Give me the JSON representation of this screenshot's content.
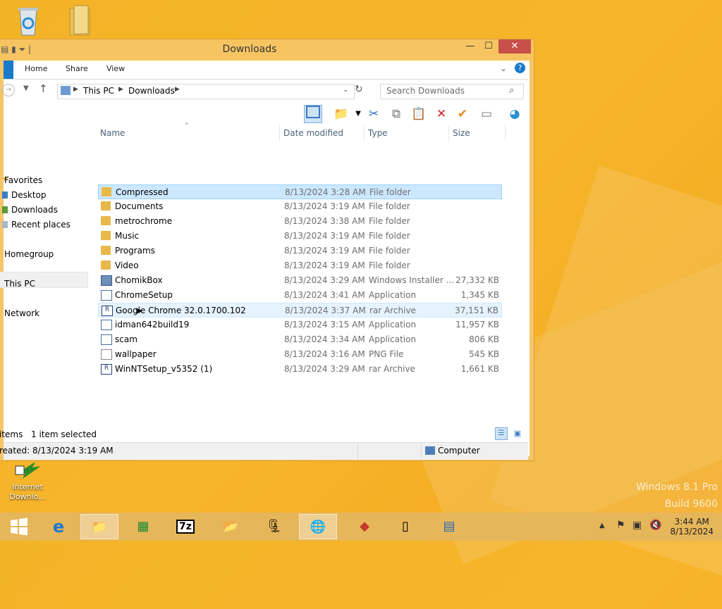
{
  "desktop": {
    "icons": [
      {
        "name": "recycle-bin-icon",
        "label": ""
      },
      {
        "name": "folder-icon",
        "label": ""
      },
      {
        "name": "internet-download-manager-icon",
        "label": "Internet Downlo..."
      }
    ],
    "watermark_line1": "Windows 8.1 Pro",
    "watermark_line2": "Build 9600"
  },
  "window": {
    "title": "Downloads",
    "controls": {
      "minimize": "—",
      "maximize": "☐",
      "close": "✕"
    }
  },
  "ribbon": {
    "tabs": [
      "Home",
      "Share",
      "View"
    ]
  },
  "address": {
    "breadcrumb": [
      "This PC",
      "Downloads"
    ],
    "search_placeholder": "Search Downloads"
  },
  "nav": {
    "favorites": "Favorites",
    "items": [
      "Desktop",
      "Downloads",
      "Recent places"
    ],
    "homegroup": "Homegroup",
    "this_pc": "This PC",
    "network": "Network"
  },
  "columns": {
    "name": "Name",
    "date": "Date modified",
    "type": "Type",
    "size": "Size"
  },
  "files": [
    {
      "name": "Compressed",
      "date": "8/13/2024 3:28 AM",
      "type": "File folder",
      "size": "",
      "icon": "folder"
    },
    {
      "name": "Documents",
      "date": "8/13/2024 3:19 AM",
      "type": "File folder",
      "size": "",
      "icon": "folder"
    },
    {
      "name": "metrochrome",
      "date": "8/13/2024 3:38 AM",
      "type": "File folder",
      "size": "",
      "icon": "folder"
    },
    {
      "name": "Music",
      "date": "8/13/2024 3:19 AM",
      "type": "File folder",
      "size": "",
      "icon": "folder"
    },
    {
      "name": "Programs",
      "date": "8/13/2024 3:19 AM",
      "type": "File folder",
      "size": "",
      "icon": "folder"
    },
    {
      "name": "Video",
      "date": "8/13/2024 3:19 AM",
      "type": "File folder",
      "size": "",
      "icon": "folder"
    },
    {
      "name": "ChomikBox",
      "date": "8/13/2024 3:29 AM",
      "type": "Windows Installer ...",
      "size": "27,332 KB",
      "icon": "installer"
    },
    {
      "name": "ChromeSetup",
      "date": "8/13/2024 3:41 AM",
      "type": "Application",
      "size": "1,345 KB",
      "icon": "app"
    },
    {
      "name": "Google Chrome 32.0.1700.102",
      "date": "8/13/2024 3:37 AM",
      "type": "rar Archive",
      "size": "37,151 KB",
      "icon": "rar"
    },
    {
      "name": "idman642build19",
      "date": "8/13/2024 3:15 AM",
      "type": "Application",
      "size": "11,957 KB",
      "icon": "app"
    },
    {
      "name": "scam",
      "date": "8/13/2024 3:34 AM",
      "type": "Application",
      "size": "806 KB",
      "icon": "app"
    },
    {
      "name": "wallpaper",
      "date": "8/13/2024 3:16 AM",
      "type": "PNG File",
      "size": "545 KB",
      "icon": "image"
    },
    {
      "name": "WinNTSetup_v5352 (1)",
      "date": "8/13/2024 3:29 AM",
      "type": "rar Archive",
      "size": "1,661 KB",
      "icon": "rar"
    }
  ],
  "status": {
    "items": "items",
    "selected": "1 item selected"
  },
  "details": {
    "created": "reated: 8/13/2024 3:19 AM",
    "location": "Computer"
  },
  "taskbar": {
    "time": "3:44 AM",
    "date": "8/13/2024"
  },
  "colors": {
    "selection": "#cce8ff",
    "accent": "#1979ca",
    "frame": "#f7c868",
    "close": "#c7514a"
  }
}
